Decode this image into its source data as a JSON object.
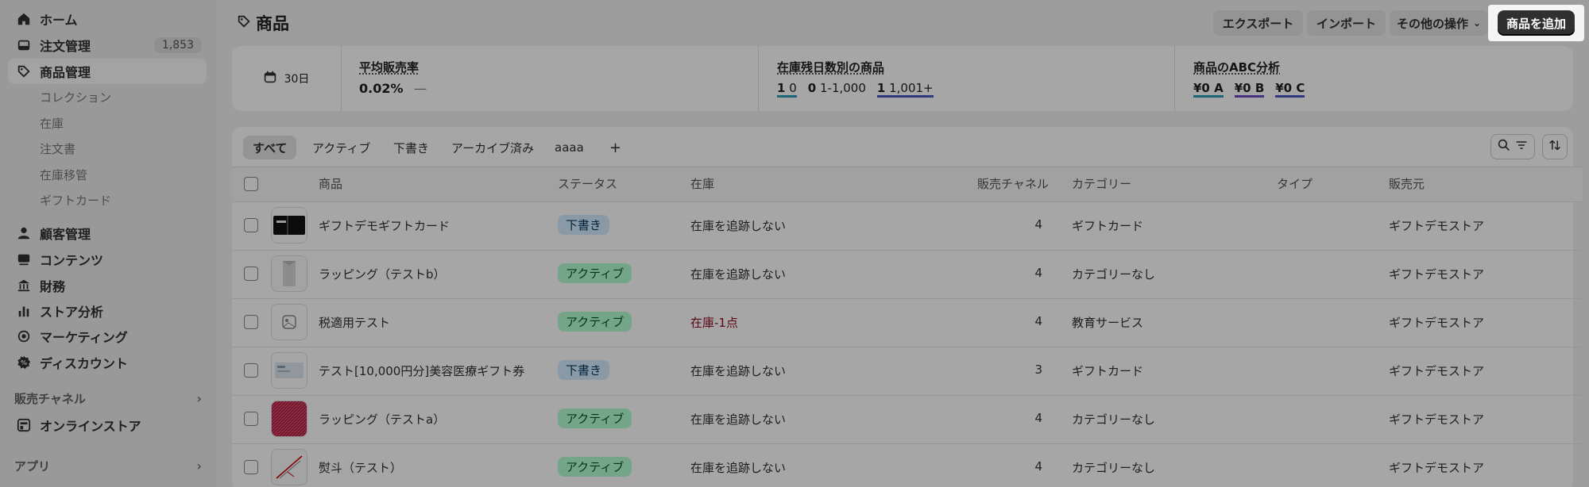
{
  "sidebar": {
    "items": [
      {
        "label": "ホーム",
        "icon": "home-icon"
      },
      {
        "label": "注文管理",
        "icon": "inbox-icon",
        "count": "1,853"
      },
      {
        "label": "商品管理",
        "icon": "tag-icon"
      }
    ],
    "subitems": [
      "コレクション",
      "在庫",
      "注文書",
      "在庫移管",
      "ギフトカード"
    ],
    "items2": [
      {
        "label": "顧客管理",
        "icon": "person-icon"
      },
      {
        "label": "コンテンツ",
        "icon": "content-icon"
      },
      {
        "label": "財務",
        "icon": "bank-icon"
      },
      {
        "label": "ストア分析",
        "icon": "chart-icon"
      },
      {
        "label": "マーケティング",
        "icon": "target-icon"
      },
      {
        "label": "ディスカウント",
        "icon": "discount-icon"
      }
    ],
    "sales_channels": "販売チャネル",
    "online_store": "オンラインストア",
    "apps": "アプリ"
  },
  "header": {
    "title": "商品",
    "export": "エクスポート",
    "import": "インポート",
    "more": "その他の操作",
    "add": "商品を追加"
  },
  "stats": {
    "range": "30日",
    "avg_label": "平均販売率",
    "avg_value": "0.02%",
    "avg_dash": "—",
    "inv_label": "在庫残日数別の商品",
    "inv": [
      {
        "n": "1",
        "t": "0"
      },
      {
        "n": "0",
        "t": "1-1,000"
      },
      {
        "n": "1",
        "t": "1,001+"
      }
    ],
    "abc_label": "商品のABC分析",
    "abc": [
      "¥0 A",
      "¥0 B",
      "¥0 C"
    ]
  },
  "tabs": [
    "すべて",
    "アクティブ",
    "下書き",
    "アーカイブ済み",
    "aaaa",
    "+"
  ],
  "columns": [
    "商品",
    "ステータス",
    "在庫",
    "販売チャネル",
    "カテゴリー",
    "タイプ",
    "販売元"
  ],
  "rows": [
    {
      "name": "ギフトデモギフトカード",
      "status": "下書き",
      "inv": "在庫を追跡しない",
      "ch": "4",
      "cat": "ギフトカード",
      "vendor": "ギフトデモストア"
    },
    {
      "name": "ラッピング（テストb）",
      "status": "アクティブ",
      "inv": "在庫を追跡しない",
      "ch": "4",
      "cat": "カテゴリーなし",
      "vendor": "ギフトデモストア"
    },
    {
      "name": "税適用テスト",
      "status": "アクティブ",
      "inv": "在庫-1点",
      "ch": "4",
      "cat": "教育サービス",
      "vendor": "ギフトデモストア"
    },
    {
      "name": "テスト[10,000円分]美容医療ギフト券",
      "status": "下書き",
      "inv": "在庫を追跡しない",
      "ch": "3",
      "cat": "ギフトカード",
      "vendor": "ギフトデモストア"
    },
    {
      "name": "ラッピング（テストa）",
      "status": "アクティブ",
      "inv": "在庫を追跡しない",
      "ch": "4",
      "cat": "カテゴリーなし",
      "vendor": "ギフトデモストア"
    },
    {
      "name": "熨斗（テスト）",
      "status": "アクティブ",
      "inv": "在庫を追跡しない",
      "ch": "4",
      "cat": "カテゴリーなし",
      "vendor": "ギフトデモストア"
    }
  ],
  "colors": {
    "active_bg": "#b4fed2",
    "active_fg": "#0c5132",
    "draft_bg": "#d5ebff",
    "draft_fg": "#003a5a",
    "stock_neg": "#8e0b21"
  }
}
